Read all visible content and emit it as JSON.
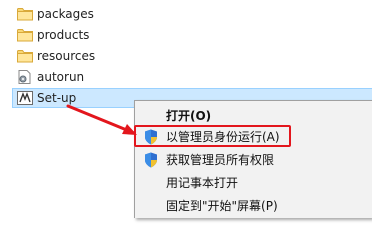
{
  "files": [
    {
      "name": "packages",
      "icon": "folder-icon"
    },
    {
      "name": "products",
      "icon": "folder-icon"
    },
    {
      "name": "resources",
      "icon": "folder-icon"
    },
    {
      "name": "autorun",
      "icon": "autorun-settings-icon"
    },
    {
      "name": "Set-up",
      "icon": "setup-app-icon",
      "selected": true
    }
  ],
  "context_menu": {
    "items": [
      {
        "label": "打开(O)",
        "icon": null,
        "bold": true
      },
      {
        "label": "以管理员身份运行(A)",
        "icon": "uac-shield-icon",
        "highlighted_box": true
      },
      {
        "label": "获取管理员所有权限",
        "icon": "uac-shield-icon"
      },
      {
        "label": "用记事本打开",
        "icon": null
      },
      {
        "label": "固定到\"开始\"屏幕(P)",
        "icon": null
      }
    ]
  },
  "colors": {
    "selection_bg": "#cce8ff",
    "selection_border": "#99d1ff",
    "annotation_red": "#e3161d",
    "folder_yellow": "#f8d775"
  }
}
